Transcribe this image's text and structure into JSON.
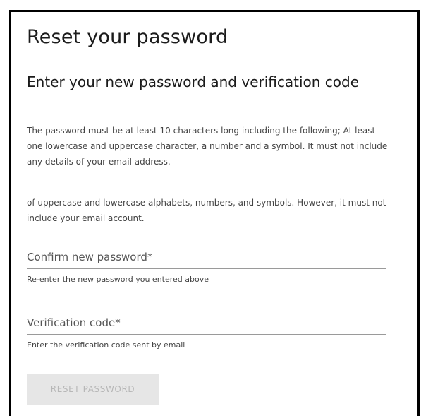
{
  "page": {
    "title": "Reset your password",
    "subtitle": "Enter your new password and verification code"
  },
  "rules": {
    "requirements": "The password must be at least 10 characters long including the following; At least one lowercase and uppercase character, a number and a symbol. It must not include any details of your email address.",
    "requirements_extra": "of uppercase and lowercase alphabets, numbers, and symbols. However, it must not include your email account."
  },
  "form": {
    "confirm_password": {
      "placeholder": "Confirm new password*",
      "value": "",
      "helper": "Re-enter the new password you entered above"
    },
    "verification_code": {
      "placeholder": "Verification code*",
      "value": "",
      "helper": "Enter the verification code sent by email"
    },
    "submit": {
      "label": "RESET PASSWORD",
      "state": "disabled"
    }
  },
  "colors": {
    "frame_border": "#000000",
    "button_background": "#e6e6e6",
    "button_text": "#b7b7b7",
    "field_underline": "#9a9a9a"
  }
}
